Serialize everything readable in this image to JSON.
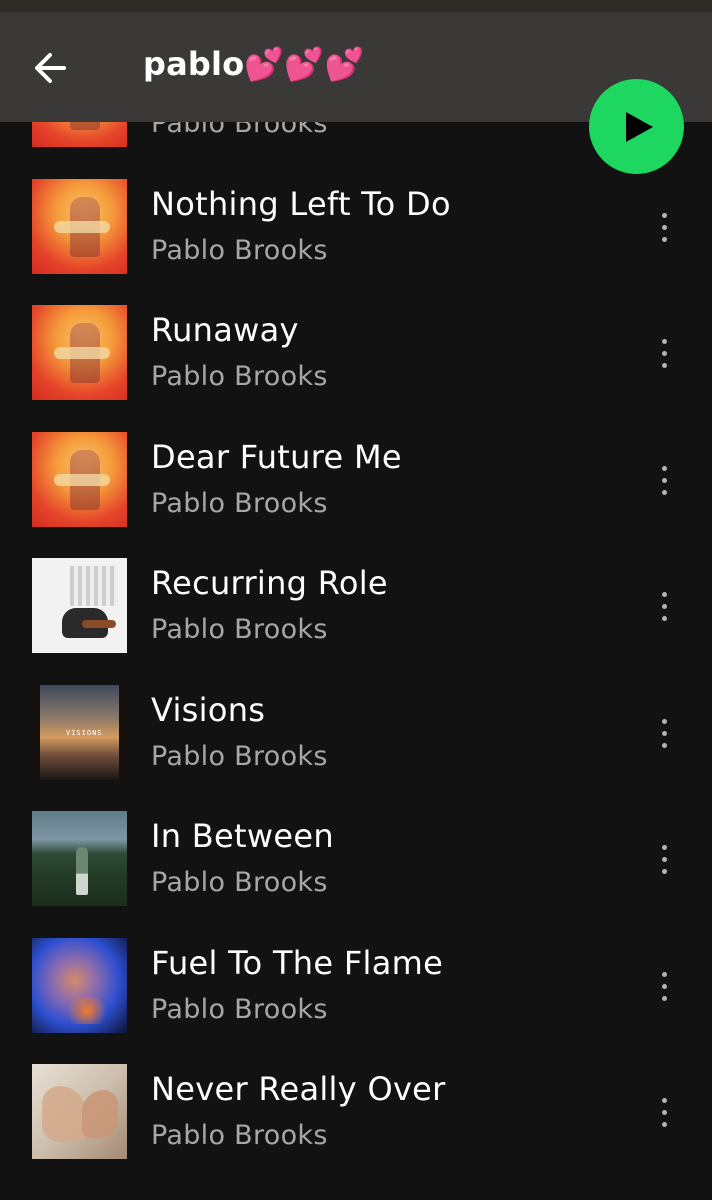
{
  "header": {
    "title": "pablo💕💕💕",
    "back_icon": "arrow-left-icon",
    "play_icon": "play-icon",
    "accent_color": "#1ed760"
  },
  "tracks": [
    {
      "title": "",
      "artist": "Pablo Brooks",
      "art": "orange"
    },
    {
      "title": "Nothing Left To Do",
      "artist": "Pablo Brooks",
      "art": "orange"
    },
    {
      "title": "Runaway",
      "artist": "Pablo Brooks",
      "art": "orange"
    },
    {
      "title": "Dear Future Me",
      "artist": "Pablo Brooks",
      "art": "orange"
    },
    {
      "title": "Recurring Role",
      "artist": "Pablo Brooks",
      "art": "white-room-guitar"
    },
    {
      "title": "Visions",
      "artist": "Pablo Brooks",
      "art": "sunset-sky",
      "art_text": "VISIONS"
    },
    {
      "title": "In Between",
      "artist": "Pablo Brooks",
      "art": "field-figure"
    },
    {
      "title": "Fuel To The Flame",
      "artist": "Pablo Brooks",
      "art": "blue-blur-portrait"
    },
    {
      "title": "Never Really Over",
      "artist": "Pablo Brooks",
      "art": "hands-over-face"
    }
  ]
}
